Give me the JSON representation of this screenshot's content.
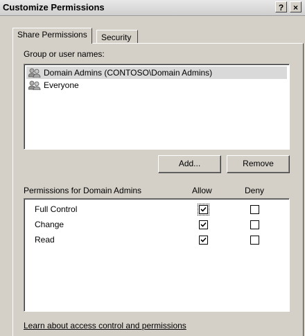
{
  "window": {
    "title": "Customize Permissions",
    "help_button": "?",
    "close_button": "×"
  },
  "tabs": [
    {
      "label": "Share Permissions",
      "active": true
    },
    {
      "label": "Security",
      "active": false
    }
  ],
  "users_section": {
    "label": "Group or user names:",
    "items": [
      {
        "name": "Domain Admins (CONTOSO\\Domain Admins)",
        "icon": "group-users-icon",
        "selected": true
      },
      {
        "name": "Everyone",
        "icon": "group-users-icon",
        "selected": false
      }
    ],
    "add_label": "Add...",
    "remove_label": "Remove"
  },
  "permissions_section": {
    "label": "Permissions for Domain Admins",
    "allow_header": "Allow",
    "deny_header": "Deny",
    "rows": [
      {
        "name": "Full Control",
        "allow": true,
        "deny": false
      },
      {
        "name": "Change",
        "allow": true,
        "deny": false
      },
      {
        "name": "Read",
        "allow": true,
        "deny": false
      }
    ]
  },
  "help_link": "Learn about access control and permissions"
}
